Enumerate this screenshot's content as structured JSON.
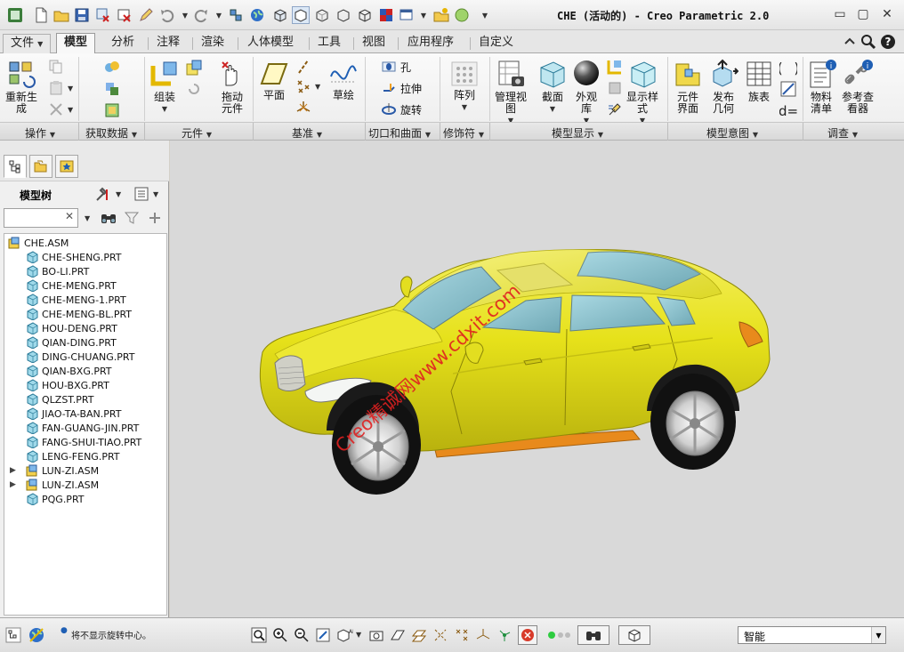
{
  "window": {
    "title": "CHE (活动的) - Creo Parametric 2.0",
    "minimize": "▭",
    "restore": "▢",
    "close": "✕"
  },
  "tabs": [
    {
      "label": "文件",
      "has_dropdown": true
    },
    {
      "label": "模型",
      "active": true
    },
    {
      "label": "分析"
    },
    {
      "label": "注释"
    },
    {
      "label": "渲染"
    },
    {
      "label": "人体模型"
    },
    {
      "label": "工具"
    },
    {
      "label": "视图"
    },
    {
      "label": "应用程序"
    },
    {
      "label": "自定义"
    }
  ],
  "ribbon": {
    "regenerate": "重新生\n成",
    "assemble": "组装",
    "drag_components": "拖动\n元件",
    "plane": "平面",
    "sketch": "草绘",
    "hole": "孔",
    "extrude": "拉伸",
    "revolve": "旋转",
    "pattern": "阵列",
    "manage_views": "管理视\n图",
    "section": "截面",
    "appearance_gallery": "外观\n库",
    "display_style": "显示样\n式",
    "component_interface": "元件\n界面",
    "publish_geometry": "发布\n几何",
    "family_table": "族表",
    "bill_of_materials": "物料\n清单",
    "reference_viewer": "参考查\n看器"
  },
  "groups": [
    {
      "label": "操作"
    },
    {
      "label": "获取数据"
    },
    {
      "label": "元件"
    },
    {
      "label": "基准"
    },
    {
      "label": "切口和曲面"
    },
    {
      "label": "修饰符"
    },
    {
      "label": "模型显示"
    },
    {
      "label": "模型意图"
    },
    {
      "label": "调查"
    }
  ],
  "left_panel": {
    "tree_title": "模型树",
    "search_value": "",
    "clear_search": "✕"
  },
  "model_tree": [
    {
      "label": "CHE.ASM",
      "type": "asm"
    },
    {
      "label": "CHE-SHENG.PRT",
      "type": "prt"
    },
    {
      "label": "BO-LI.PRT",
      "type": "prt"
    },
    {
      "label": "CHE-MENG.PRT",
      "type": "prt"
    },
    {
      "label": "CHE-MENG-1.PRT",
      "type": "prt"
    },
    {
      "label": "CHE-MENG-BL.PRT",
      "type": "prt"
    },
    {
      "label": "HOU-DENG.PRT",
      "type": "prt"
    },
    {
      "label": "QIAN-DING.PRT",
      "type": "prt"
    },
    {
      "label": "DING-CHUANG.PRT",
      "type": "prt"
    },
    {
      "label": "QIAN-BXG.PRT",
      "type": "prt"
    },
    {
      "label": "HOU-BXG.PRT",
      "type": "prt"
    },
    {
      "label": "QLZST.PRT",
      "type": "prt"
    },
    {
      "label": "JIAO-TA-BAN.PRT",
      "type": "prt"
    },
    {
      "label": "FAN-GUANG-JIN.PRT",
      "type": "prt"
    },
    {
      "label": "FANG-SHUI-TIAO.PRT",
      "type": "prt"
    },
    {
      "label": "LENG-FENG.PRT",
      "type": "prt"
    },
    {
      "label": "LUN-ZI.ASM",
      "type": "asm",
      "expandable": true
    },
    {
      "label": "LUN-ZI.ASM",
      "type": "asm",
      "expandable": true
    },
    {
      "label": "PQG.PRT",
      "type": "prt"
    }
  ],
  "viewport": {
    "watermark": "Creo精诚网www.cdxit.com",
    "model": "yellow SUV assembly",
    "background_color": "#d9d9d9",
    "body_color": "#e8e31a",
    "glass_color": "#8fc4cf",
    "trim_color": "#e88a1c"
  },
  "status_bar": {
    "message": "将不显示旋转中心。",
    "filter_value": "智能",
    "filter_arrow": "▼"
  },
  "colors": {
    "accent_blue": "#1f5fb4",
    "watermark_red": "#e02020"
  }
}
